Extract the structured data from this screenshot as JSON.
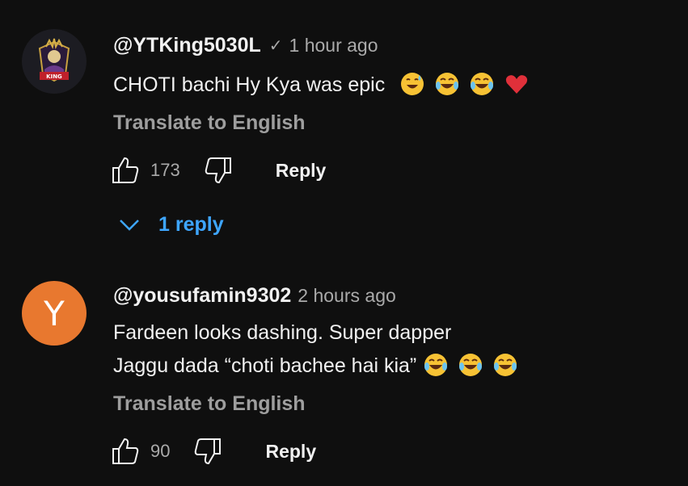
{
  "comments": [
    {
      "author": "@YTKing5030L",
      "verified_mark": "✓",
      "time": "1 hour ago",
      "text_lines": [
        "CHOTI bachi Hy Kya was epic"
      ],
      "translate_label": "Translate to English",
      "likes": "173",
      "reply_label": "Reply",
      "replies_label": "1 reply",
      "avatar_text": "KING"
    },
    {
      "author": "@yousufamin9302",
      "time": "2 hours ago",
      "text_lines": [
        "Fardeen looks dashing. Super dapper",
        "Jaggu dada “choti bachee hai kia”"
      ],
      "translate_label": "Translate to English",
      "likes": "90",
      "reply_label": "Reply",
      "avatar_initial": "Y"
    }
  ],
  "colors": {
    "background": "#0f0f0f",
    "link_blue": "#3ea6ff",
    "avatar_orange": "#e8782f",
    "muted": "#aaaaaa"
  },
  "icons": [
    "thumbs-up-icon",
    "thumbs-down-icon",
    "chevron-down-icon",
    "verified-check-icon",
    "grinning-sweat-emoji",
    "tears-of-joy-emoji",
    "red-heart-emoji"
  ]
}
